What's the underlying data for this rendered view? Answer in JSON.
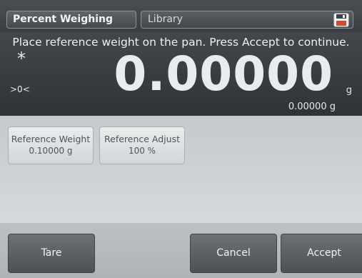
{
  "header": {
    "mode_tab": "Percent Weighing",
    "library_tab": "Library",
    "save_icon": "floppy-disk-icon"
  },
  "display": {
    "instruction": "Place reference weight on the pan.  Press Accept to continue.",
    "stable_indicator": "*",
    "zero_indicator": ">0<",
    "main_value": "0.00000",
    "main_unit": "g",
    "secondary_value": "0.00000 g"
  },
  "parameters": [
    {
      "label": "Reference Weight",
      "value": "0.10000 g"
    },
    {
      "label": "Reference Adjust",
      "value": "100 %"
    }
  ],
  "actions": {
    "tare": "Tare",
    "cancel": "Cancel",
    "accept": "Accept"
  },
  "colors": {
    "dark_panel": "#3a3e42",
    "light_panel": "#cfd3d6",
    "action_button": "#5b6165"
  }
}
